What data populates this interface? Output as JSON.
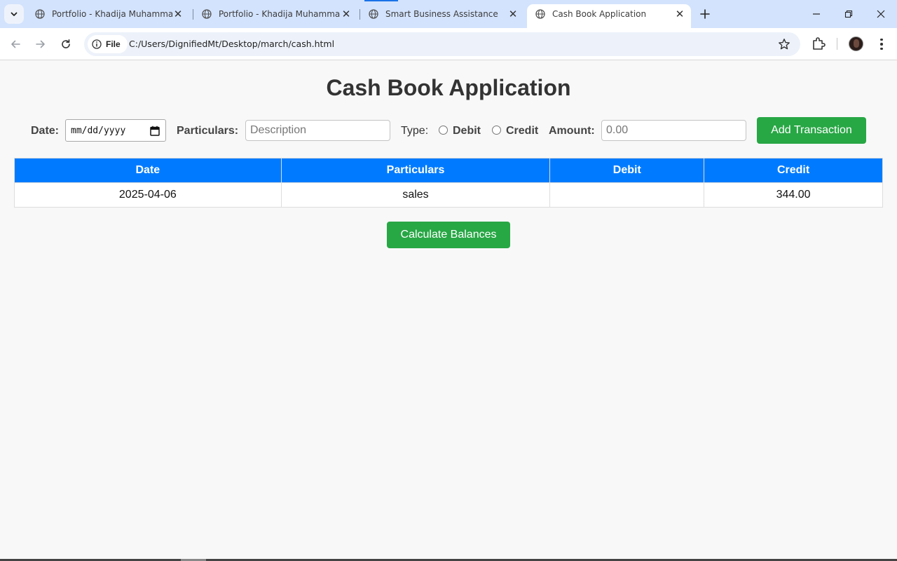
{
  "browser": {
    "tabs": [
      {
        "title": "Portfolio - Khadija Muhammad",
        "active": false
      },
      {
        "title": "Portfolio - Khadija Muhammad",
        "active": false
      },
      {
        "title": "Smart Business Assistance",
        "active": false
      },
      {
        "title": "Cash Book Application",
        "active": true
      }
    ],
    "site_chip": "File",
    "url": "C:/Users/DignifiedMt/Desktop/march/cash.html"
  },
  "app": {
    "title": "Cash Book Application",
    "form": {
      "date_label": "Date:",
      "date_value": "mm/dd/yyyy",
      "particulars_label": "Particulars:",
      "particulars_placeholder": "Description",
      "type_label": "Type:",
      "debit_label": "Debit",
      "credit_label": "Credit",
      "amount_label": "Amount:",
      "amount_placeholder": "0.00",
      "add_button": "Add Transaction"
    },
    "table": {
      "headers": [
        "Date",
        "Particulars",
        "Debit",
        "Credit"
      ],
      "rows": [
        {
          "date": "2025-04-06",
          "particulars": "sales",
          "debit": "",
          "credit": "344.00"
        }
      ]
    },
    "calculate_button": "Calculate Balances"
  },
  "colors": {
    "header_blue": "#007bff",
    "button_green": "#28a745",
    "tabstrip": "#d3e3fd"
  }
}
